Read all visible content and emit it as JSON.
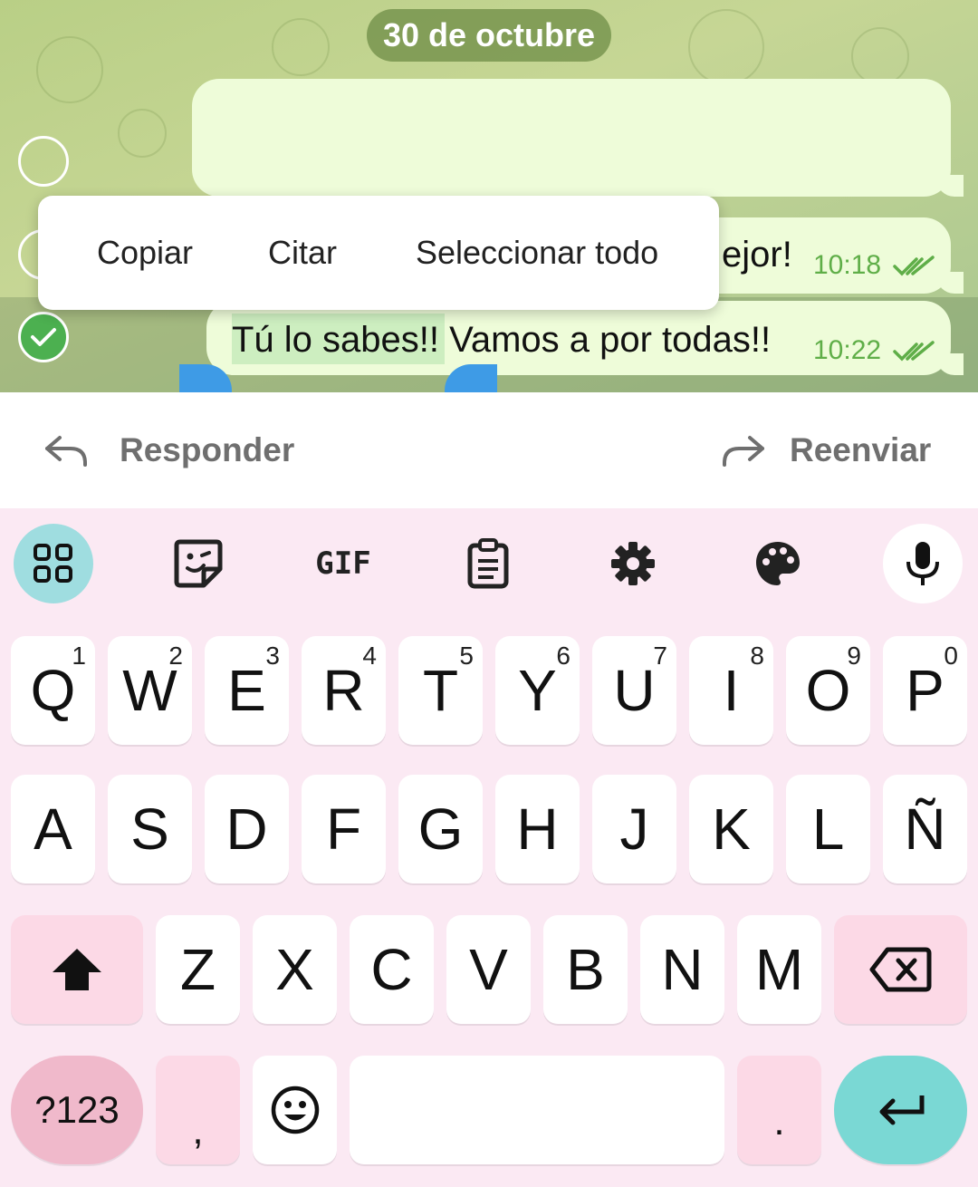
{
  "chat": {
    "date": "30 de octubre",
    "messages": [
      {
        "text": "",
        "time": ""
      },
      {
        "text": "ejor!",
        "time": "10:18"
      },
      {
        "text": "Tú lo sabes!! Vamos a por todas!!",
        "time": "10:22"
      }
    ]
  },
  "context_menu": {
    "copy": "Copiar",
    "quote": "Citar",
    "select_all": "Seleccionar todo"
  },
  "action_bar": {
    "reply": "Responder",
    "forward": "Reenviar"
  },
  "keyboard": {
    "toolbar": [
      "apps-grid-icon",
      "sticker-icon",
      "gif-icon",
      "clipboard-icon",
      "settings-gear-icon",
      "palette-icon",
      "microphone-icon"
    ],
    "gif_label": "GIF",
    "row1": [
      {
        "k": "Q",
        "n": "1"
      },
      {
        "k": "W",
        "n": "2"
      },
      {
        "k": "E",
        "n": "3"
      },
      {
        "k": "R",
        "n": "4"
      },
      {
        "k": "T",
        "n": "5"
      },
      {
        "k": "Y",
        "n": "6"
      },
      {
        "k": "U",
        "n": "7"
      },
      {
        "k": "I",
        "n": "8"
      },
      {
        "k": "O",
        "n": "9"
      },
      {
        "k": "P",
        "n": "0"
      }
    ],
    "row2": [
      "A",
      "S",
      "D",
      "F",
      "G",
      "H",
      "J",
      "K",
      "L",
      "Ñ"
    ],
    "row3": [
      "Z",
      "X",
      "C",
      "V",
      "B",
      "N",
      "M"
    ],
    "symbols": "?123",
    "comma": ",",
    "period": ".",
    "colors": {
      "accent": "#7ad8d4",
      "pink_key": "#fcd9e6",
      "symbols_key": "#f0b9cb",
      "background": "#fbe9f3"
    }
  }
}
